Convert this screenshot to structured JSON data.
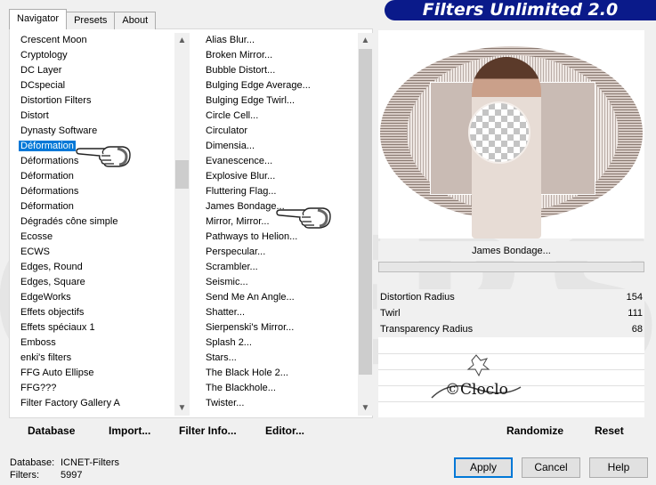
{
  "app": {
    "title": "Filters Unlimited 2.0",
    "watermark": "OVERS"
  },
  "tabs": [
    {
      "label": "Navigator",
      "active": true
    },
    {
      "label": "Presets",
      "active": false
    },
    {
      "label": "About",
      "active": false
    }
  ],
  "categories": {
    "items": [
      "Crescent Moon",
      "Cryptology",
      "DC Layer",
      "DCspecial",
      "Distortion Filters",
      "Distort",
      "Dynasty Software",
      "Déformation",
      "Déformations",
      "Déformation",
      "Déformations",
      "Déformation",
      "Dégradés cône simple",
      "Ecosse",
      "ECWS",
      "Edges, Round",
      "Edges, Square",
      "EdgeWorks",
      "Effets objectifs",
      "Effets spéciaux 1",
      "Emboss",
      "enki's filters",
      "FFG Auto Ellipse",
      "FFG???",
      "Filter Factory Gallery A"
    ],
    "selected_index": 7
  },
  "filters": {
    "items": [
      "Alias Blur...",
      "Broken Mirror...",
      "Bubble Distort...",
      "Bulging Edge Average...",
      "Bulging Edge Twirl...",
      "Circle Cell...",
      "Circulator",
      "Dimensia...",
      "Evanescence...",
      "Explosive Blur...",
      "Fluttering Flag...",
      "James Bondage...",
      "Mirror, Mirror...",
      "Pathways to Helion...",
      "Perspecular...",
      "Scrambler...",
      "Seismic...",
      "Send Me An Angle...",
      "Shatter...",
      "Sierpenski's Mirror...",
      "Splash 2...",
      "Stars...",
      "The Black Hole 2...",
      "The Blackhole...",
      "Twister..."
    ],
    "selected_index": 11
  },
  "preview": {
    "filter_name": "James Bondage...",
    "logo_text": "©Cloclo"
  },
  "parameters": [
    {
      "label": "Distortion Radius",
      "value": "154"
    },
    {
      "label": "Twirl",
      "value": "111"
    },
    {
      "label": " Transparency Radius",
      "value": "68"
    }
  ],
  "toolbar": {
    "database": "Database",
    "import": "Import...",
    "filter_info": "Filter Info...",
    "editor": "Editor...",
    "randomize": "Randomize",
    "reset": "Reset"
  },
  "status": {
    "database_label": "Database:",
    "database_value": "ICNET-Filters",
    "filters_label": "Filters:",
    "filters_value": "5997"
  },
  "buttons": {
    "apply": "Apply",
    "cancel": "Cancel",
    "help": "Help"
  }
}
